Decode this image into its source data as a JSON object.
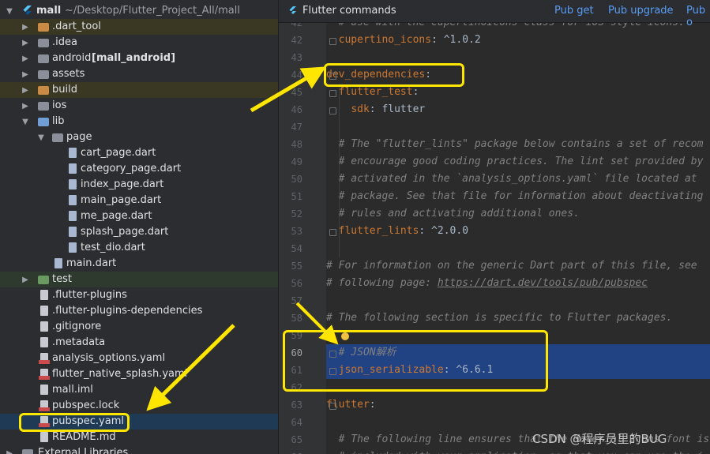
{
  "project": {
    "root_name": "mall",
    "root_path": "~/Desktop/Flutter_Project_All/mall",
    "items": [
      {
        "label": ".dart_tool",
        "extra": ""
      },
      {
        "label": ".idea",
        "extra": ""
      },
      {
        "label": "android",
        "extra": "[mall_android]"
      },
      {
        "label": "assets",
        "extra": ""
      },
      {
        "label": "build",
        "extra": ""
      },
      {
        "label": "ios",
        "extra": ""
      },
      {
        "label": "lib",
        "extra": ""
      },
      {
        "label": "page",
        "extra": ""
      },
      {
        "label": "cart_page.dart",
        "extra": ""
      },
      {
        "label": "category_page.dart",
        "extra": ""
      },
      {
        "label": "index_page.dart",
        "extra": ""
      },
      {
        "label": "main_page.dart",
        "extra": ""
      },
      {
        "label": "me_page.dart",
        "extra": ""
      },
      {
        "label": "splash_page.dart",
        "extra": ""
      },
      {
        "label": "test_dio.dart",
        "extra": ""
      },
      {
        "label": "main.dart",
        "extra": ""
      },
      {
        "label": "test",
        "extra": ""
      },
      {
        "label": ".flutter-plugins",
        "extra": ""
      },
      {
        "label": ".flutter-plugins-dependencies",
        "extra": ""
      },
      {
        "label": ".gitignore",
        "extra": ""
      },
      {
        "label": ".metadata",
        "extra": ""
      },
      {
        "label": "analysis_options.yaml",
        "extra": ""
      },
      {
        "label": "flutter_native_splash.yaml",
        "extra": ""
      },
      {
        "label": "mall.iml",
        "extra": ""
      },
      {
        "label": "pubspec.lock",
        "extra": ""
      },
      {
        "label": "pubspec.yaml",
        "extra": ""
      },
      {
        "label": "README.md",
        "extra": ""
      },
      {
        "label": "External Libraries",
        "extra": ""
      }
    ]
  },
  "editor": {
    "banner_title": "Flutter commands",
    "banner_links": [
      "Pub get",
      "Pub upgrade",
      "Pub o"
    ],
    "lines": [
      {
        "n": "42",
        "t": "  # use with the CupertinoIcons class for iOS style icons."
      },
      {
        "n": "42",
        "t": "  cupertino_icons: ^1.0.2"
      },
      {
        "n": "43",
        "t": ""
      },
      {
        "n": "44",
        "t": "dev_dependencies:"
      },
      {
        "n": "45",
        "t": "  flutter_test:"
      },
      {
        "n": "46",
        "t": "    sdk: flutter"
      },
      {
        "n": "47",
        "t": ""
      },
      {
        "n": "48",
        "t": "  # The \"flutter_lints\" package below contains a set of recom"
      },
      {
        "n": "49",
        "t": "  # encourage good coding practices. The lint set provided by"
      },
      {
        "n": "50",
        "t": "  # activated in the `analysis_options.yaml` file located at"
      },
      {
        "n": "51",
        "t": "  # package. See that file for information about deactivating"
      },
      {
        "n": "52",
        "t": "  # rules and activating additional ones."
      },
      {
        "n": "53",
        "t": "  flutter_lints: ^2.0.0"
      },
      {
        "n": "54",
        "t": ""
      },
      {
        "n": "55",
        "t": "# For information on the generic Dart part of this file, see"
      },
      {
        "n": "56",
        "t": "# following page: https://dart.dev/tools/pub/pubspec"
      },
      {
        "n": "57",
        "t": ""
      },
      {
        "n": "58",
        "t": "# The following section is specific to Flutter packages."
      },
      {
        "n": "59",
        "t": ""
      },
      {
        "n": "60",
        "t": "  # JSON解析"
      },
      {
        "n": "61",
        "t": "  json_serializable: ^6.6.1"
      },
      {
        "n": "62",
        "t": ""
      },
      {
        "n": "63",
        "t": "flutter:"
      },
      {
        "n": "64",
        "t": ""
      },
      {
        "n": "65",
        "t": "  # The following line ensures that the Material Icons font is"
      },
      {
        "n": "66",
        "t": "  # included with your application, so that you can use the i"
      }
    ]
  },
  "watermark": "CSDN @程序员里的BUG"
}
